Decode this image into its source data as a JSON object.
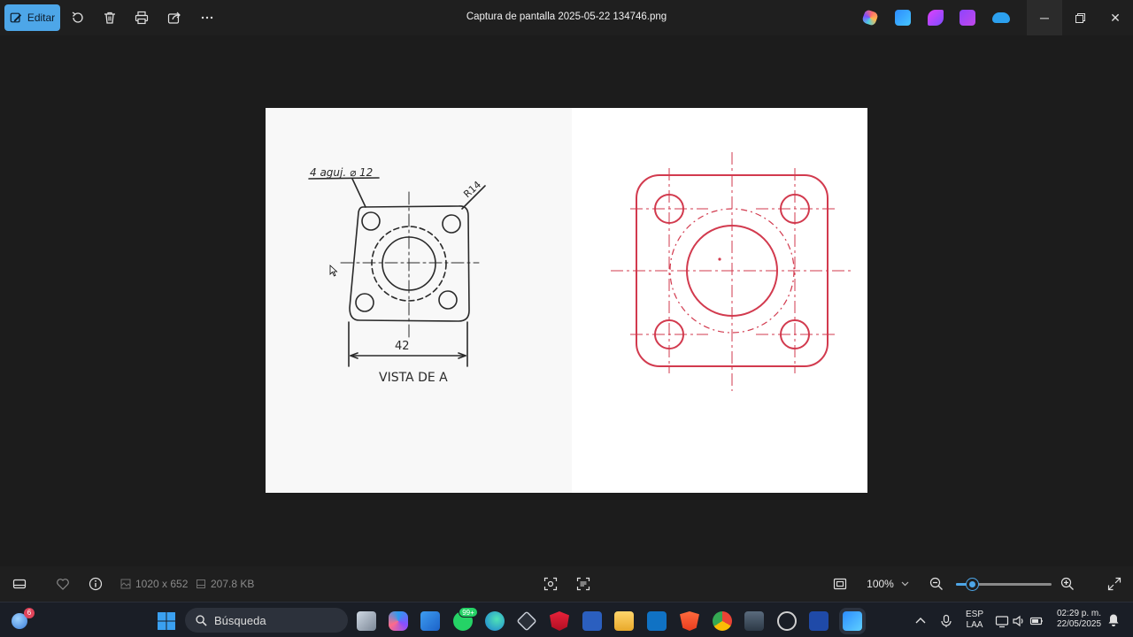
{
  "titlebar": {
    "edit_label": "Editar",
    "file_title": "Captura de pantalla 2025-05-22 134746.png",
    "toolbar_icons": [
      "rotate-icon",
      "delete-icon",
      "print-icon",
      "share-icon",
      "more-icon"
    ],
    "app_icons": [
      "copilot-icon",
      "designer-icon",
      "clipchamp-icon",
      "clipchamp-video-icon",
      "onedrive-icon"
    ],
    "window_controls": [
      "minimize-icon",
      "restore-icon",
      "close-icon"
    ]
  },
  "drawing": {
    "callout_holes": "4 aguj. ⌀ 12",
    "callout_radius": "R14",
    "dimension_width": "42",
    "view_label": "VISTA DE A"
  },
  "statusbar": {
    "dimensions": "1020 x 652",
    "filesize": "207.8 KB",
    "zoom": "100%",
    "zoom_level": 0.17
  },
  "taskbar": {
    "weather_badge": "6",
    "search_placeholder": "Búsqueda",
    "whatsapp_badge": "99+",
    "lang_top": "ESP",
    "lang_bottom": "LAA",
    "time": "02:29 p. m.",
    "date": "22/05/2025"
  },
  "colors": {
    "accent": "#4da6e8",
    "sketch_stroke": "#2a2a2a",
    "cad_stroke": "#d23a4e"
  }
}
